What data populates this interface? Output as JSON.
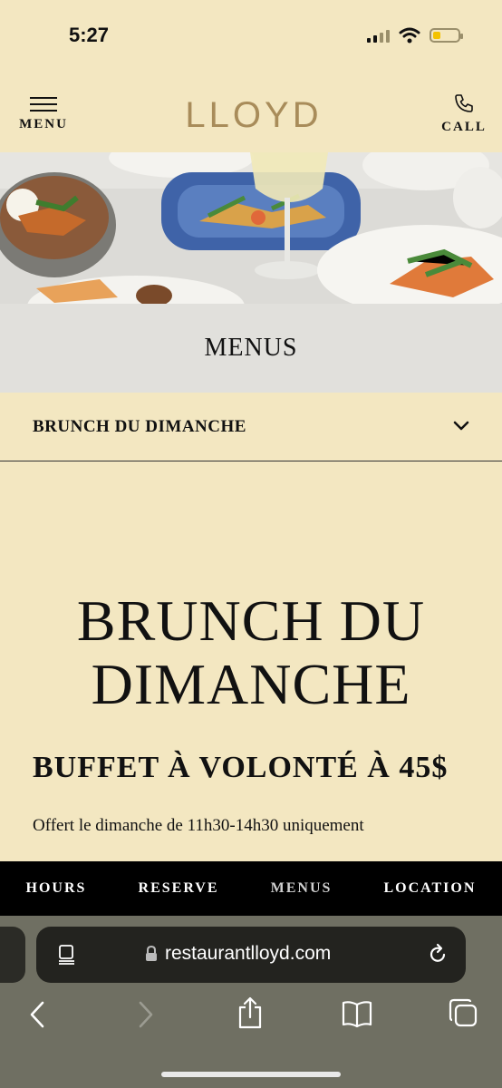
{
  "status": {
    "time": "5:27"
  },
  "header": {
    "menu_label": "MENU",
    "logo": "LLOYD",
    "call_label": "CALL"
  },
  "menus_band": {
    "title": "MENUS"
  },
  "dropdown": {
    "selected": "BRUNCH DU DIMANCHE"
  },
  "content": {
    "title_line1": "BRUNCH DU",
    "title_line2": "DIMANCHE",
    "subtitle": "BUFFET À VOLONTÉ À 45$",
    "description": "Offert le dimanche de 11h30-14h30 uniquement"
  },
  "bottom_nav": [
    "HOURS",
    "RESERVE",
    "MENUS",
    "LOCATION"
  ],
  "browser": {
    "url": "restaurantlloyd.com"
  },
  "colors": {
    "background": "#f3e7c1",
    "logo": "#a88c5a",
    "nav_bg": "#000000",
    "band": "#e1e0dc"
  },
  "battery_level": 0.3
}
